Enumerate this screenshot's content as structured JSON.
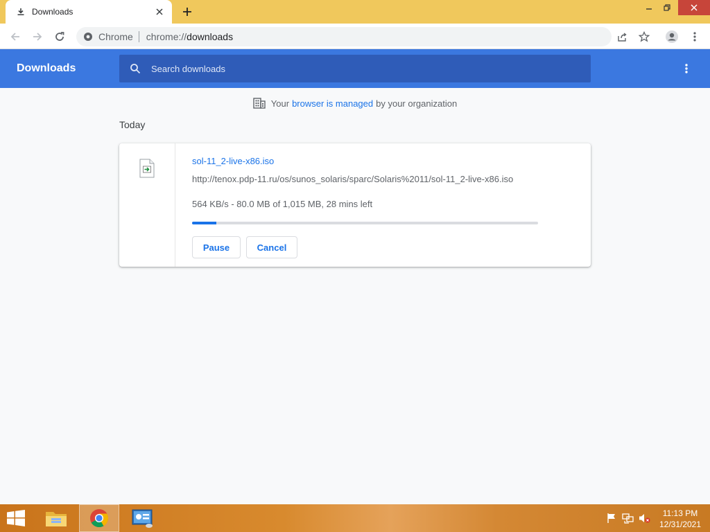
{
  "browser": {
    "tab": {
      "title": "Downloads",
      "icon": "download-icon"
    },
    "omnibox": {
      "chip": "Chrome",
      "url_scheme": "chrome://",
      "url_path": "downloads"
    }
  },
  "downloads_page": {
    "title": "Downloads",
    "search_placeholder": "Search downloads",
    "managed_notice": {
      "prefix": "Your",
      "link": "browser is managed",
      "suffix": "by your organization"
    },
    "section_date": "Today",
    "item": {
      "file_name": "sol-11_2-live-x86.iso",
      "url": "http://tenox.pdp-11.ru/os/sunos_solaris/sparc/Solaris%2011/sol-11_2-live-x86.iso",
      "status": "564 KB/s - 80.0 MB of 1,015 MB, 28 mins left",
      "progress_fraction": 0.07,
      "pause_label": "Pause",
      "cancel_label": "Cancel"
    }
  },
  "taskbar": {
    "clock_time": "11:13 PM",
    "clock_date": "12/31/2021",
    "apps": [
      "file-explorer-icon",
      "chrome-icon",
      "control-panel-icon"
    ]
  },
  "colors": {
    "accent": "#1a73e8",
    "header_blue": "#3b78e0",
    "search_blue": "#2f5cb8",
    "titlebar": "#f0c85c",
    "close_red": "#c7453a"
  }
}
